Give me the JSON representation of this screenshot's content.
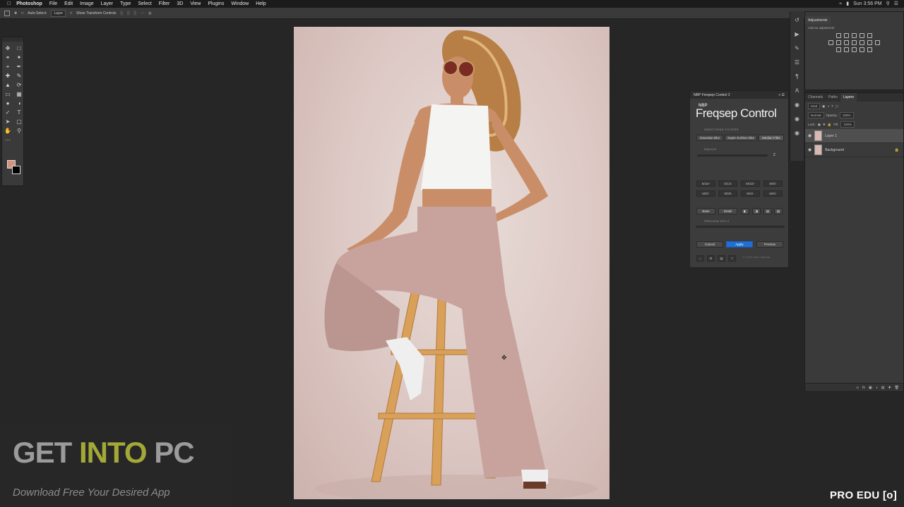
{
  "menubar": {
    "apple": "",
    "app": "Photoshop",
    "items": [
      "File",
      "Edit",
      "Image",
      "Layer",
      "Type",
      "Select",
      "Filter",
      "3D",
      "View",
      "Plugins",
      "Window",
      "Help"
    ],
    "clock": "Sun 3:56 PM"
  },
  "options": {
    "auto_select": "Auto-Select:",
    "target": "Layer",
    "transform": "Show Transform Controls"
  },
  "adjustments": {
    "tab": "Adjustments",
    "subtitle": "Add an adjustment"
  },
  "layers_panel": {
    "tabs": [
      "Channels",
      "Paths",
      "Layers"
    ],
    "filter": "Kind",
    "blend_mode": "Normal",
    "opacity_label": "Opacity:",
    "opacity": "100%",
    "lock_label": "Lock:",
    "fill_label": "Fill:",
    "fill": "100%",
    "layers": [
      {
        "name": "Layer 1",
        "selected": true
      },
      {
        "name": "Background",
        "selected": false
      }
    ]
  },
  "plugin": {
    "title": "NBP Freqsep Control 2",
    "logo_small": "NBP",
    "logo": "Freqsep Control",
    "smoothing_label": "SMOOTHING FILTERS",
    "filters": [
      "Gaussian Blur",
      "Super Surface Blur",
      "Median Filter"
    ],
    "radius_label": "RADIUS",
    "radius_value": "2",
    "presets_row1": [
      "8/16/-",
      "5/1/3",
      "M/32/-",
      "M/5/-"
    ],
    "presets_row2": [
      "M/6/-",
      "5/6/9",
      "M/4/-",
      "M/6/-"
    ],
    "base": "Base",
    "detail": "Detail",
    "preview_split": "PREVIEW SPLIT",
    "cancel": "Cancel",
    "apply": "Apply",
    "preview": "Preview",
    "copyright": "© 2020 Nino Batista"
  },
  "watermark": {
    "get": "GET ",
    "into": "INTO",
    "pc": " PC",
    "subtitle": "Download Free Your Desired App"
  },
  "corner_brand": "PRO EDU [o]"
}
